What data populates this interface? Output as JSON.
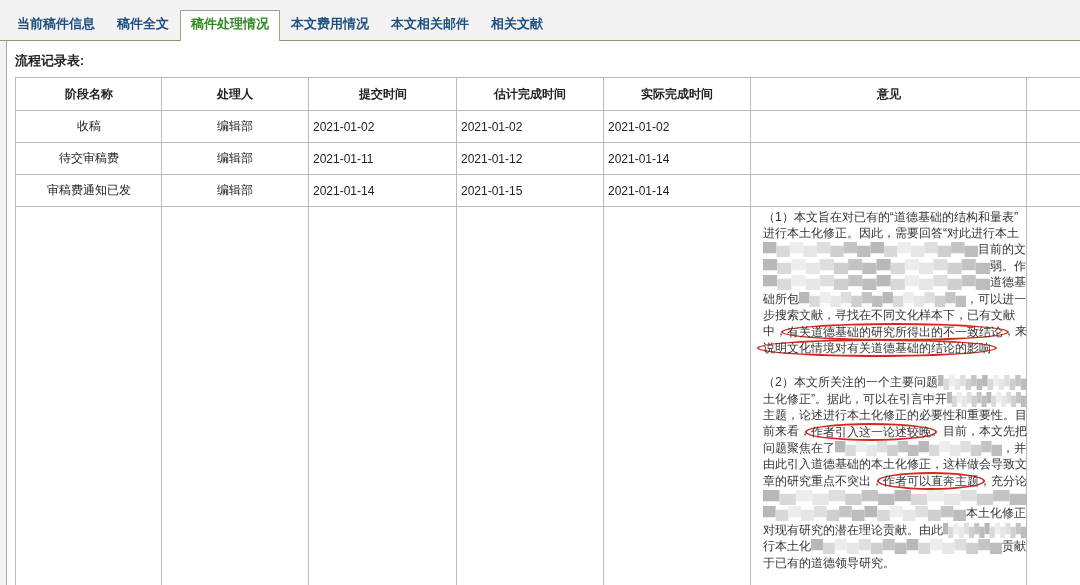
{
  "tabs": [
    {
      "label": "当前稿件信息",
      "selected": false
    },
    {
      "label": "稿件全文",
      "selected": false
    },
    {
      "label": "稿件处理情况",
      "selected": true
    },
    {
      "label": "本文费用情况",
      "selected": false
    },
    {
      "label": "本文相关邮件",
      "selected": false
    },
    {
      "label": "相关文献",
      "selected": false
    }
  ],
  "section_title": "流程记录表:",
  "table": {
    "columns": [
      "阶段名称",
      "处理人",
      "提交时间",
      "估计完成时间",
      "实际完成时间",
      "意见"
    ],
    "rows": [
      {
        "stage": "收稿",
        "handler": "编辑部",
        "submitted": "2021-01-02",
        "estimated": "2021-01-02",
        "actual": "2021-01-02"
      },
      {
        "stage": "待交审稿费",
        "handler": "编辑部",
        "submitted": "2021-01-11",
        "estimated": "2021-01-12",
        "actual": "2021-01-14"
      },
      {
        "stage": "审稿费通知已发",
        "handler": "编辑部",
        "submitted": "2021-01-14",
        "estimated": "2021-01-15",
        "actual": "2021-01-14"
      }
    ],
    "opinion": [
      {
        "lines": [
          {
            "parts": [
              {
                "kind": "text",
                "text": "（1）本文旨在对已有的“道德基础的结构和量表”",
                "circled": false
              }
            ]
          },
          {
            "parts": [
              {
                "kind": "text",
                "text": "进行本土化修正。因此，需要回答“对此进行本土",
                "circled": false
              }
            ]
          },
          {
            "parts": [
              {
                "kind": "blur"
              },
              {
                "kind": "text",
                "text": "目前的文",
                "circled": false
              }
            ]
          },
          {
            "parts": [
              {
                "kind": "blur"
              },
              {
                "kind": "text",
                "text": "弱。作",
                "circled": false
              }
            ]
          },
          {
            "parts": [
              {
                "kind": "blur"
              },
              {
                "kind": "text",
                "text": "道德基",
                "circled": false
              }
            ]
          },
          {
            "parts": [
              {
                "kind": "text",
                "text": "础所包",
                "circled": false
              },
              {
                "kind": "blur"
              },
              {
                "kind": "text",
                "text": "，可以进一",
                "circled": false
              }
            ]
          },
          {
            "parts": [
              {
                "kind": "text",
                "text": "步搜索文献，寻找在不同文化样本下，已有文献",
                "circled": false
              }
            ]
          },
          {
            "parts": [
              {
                "kind": "text",
                "text": "中，",
                "circled": false
              },
              {
                "kind": "text",
                "text": "有关道德基础的研究所得出的不一致结论",
                "circled": true
              },
              {
                "kind": "text",
                "text": "，来",
                "circled": false
              }
            ]
          },
          {
            "parts": [
              {
                "kind": "text",
                "text": "说明文化情境对有关道德基础的结论的影响",
                "circled": true
              }
            ]
          }
        ]
      },
      {
        "lines": [
          {
            "parts": [
              {
                "kind": "text",
                "text": "（2）本文所关注的一个主要问题",
                "circled": false
              },
              {
                "kind": "blur"
              }
            ]
          },
          {
            "parts": [
              {
                "kind": "text",
                "text": "土化修正”。据此，可以在引言中开",
                "circled": false
              },
              {
                "kind": "blur"
              }
            ]
          },
          {
            "parts": [
              {
                "kind": "text",
                "text": "主题，论述进行本土化修正的必要性和重要性。目",
                "circled": false
              }
            ]
          },
          {
            "parts": [
              {
                "kind": "text",
                "text": "前来看，",
                "circled": false
              },
              {
                "kind": "text",
                "text": "作者引入这一论述较晚",
                "circled": true
              },
              {
                "kind": "text",
                "text": "。目前，本文先把",
                "circled": false
              }
            ]
          },
          {
            "parts": [
              {
                "kind": "text",
                "text": "问题聚焦在了",
                "circled": false
              },
              {
                "kind": "blur"
              },
              {
                "kind": "text",
                "text": "，并",
                "circled": false
              }
            ]
          },
          {
            "parts": [
              {
                "kind": "text",
                "text": "由此引入道德基础的本土化修正，这样做会导致文",
                "circled": false
              }
            ]
          },
          {
            "parts": [
              {
                "kind": "text",
                "text": "章的研究重点不突出，",
                "circled": false
              },
              {
                "kind": "text",
                "text": "作者可以直奔主题",
                "circled": true
              },
              {
                "kind": "text",
                "text": "，充分论",
                "circled": false
              }
            ]
          },
          {
            "parts": [
              {
                "kind": "blur"
              }
            ]
          },
          {
            "parts": [
              {
                "kind": "blur"
              },
              {
                "kind": "text",
                "text": "本土化修正",
                "circled": false
              }
            ]
          },
          {
            "parts": [
              {
                "kind": "text",
                "text": "对现有研究的潜在理论贡献。由此",
                "circled": false
              },
              {
                "kind": "blur"
              }
            ]
          },
          {
            "parts": [
              {
                "kind": "text",
                "text": "行本土化",
                "circled": false
              },
              {
                "kind": "blur"
              },
              {
                "kind": "text",
                "text": "贡献",
                "circled": false
              }
            ]
          },
          {
            "parts": [
              {
                "kind": "text",
                "text": "于已有的道德领导研究。",
                "circled": false
              }
            ]
          }
        ]
      }
    ]
  }
}
